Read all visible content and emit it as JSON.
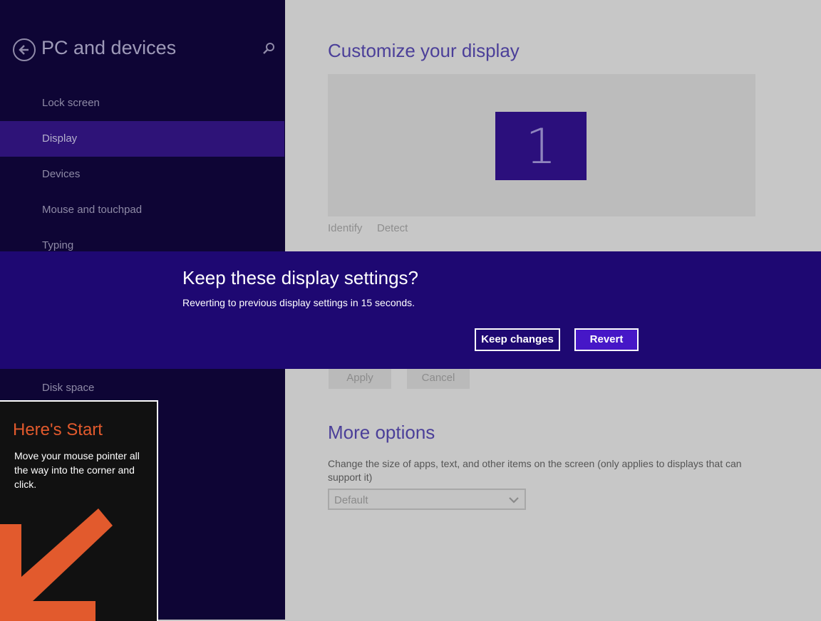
{
  "sidebar": {
    "title": "PC and devices",
    "items": [
      {
        "label": "Lock screen",
        "selected": false
      },
      {
        "label": "Display",
        "selected": true
      },
      {
        "label": "Devices",
        "selected": false
      },
      {
        "label": "Mouse and touchpad",
        "selected": false
      },
      {
        "label": "Typing",
        "selected": false
      },
      {
        "label": "Disk space",
        "selected": false
      }
    ]
  },
  "content": {
    "heading": "Customize your display",
    "monitor_number": "1",
    "identify_link": "Identify",
    "detect_link": "Detect",
    "apply_button": "Apply",
    "cancel_button": "Cancel",
    "more_heading": "More options",
    "more_description": "Change the size of apps, text, and other items on the screen (only applies to displays that can support it)",
    "size_select_value": "Default"
  },
  "dialog": {
    "title": "Keep these display settings?",
    "message": "Reverting to previous display settings in 15 seconds.",
    "keep_button": "Keep changes",
    "revert_button": "Revert"
  },
  "tip": {
    "title": "Here's Start",
    "text": "Move your mouse pointer all the way into the corner and click."
  },
  "colors": {
    "sidebar_bg": "#0e0535",
    "selected_item": "#2e1378",
    "dialog_bg": "#1e0872",
    "accent": "#4617c7",
    "tip_orange": "#e25a2d"
  },
  "icons": {
    "back": "back-arrow-icon",
    "search": "search-icon",
    "dropdown": "chevron-down-icon",
    "tip_arrow": "corner-arrow-icon"
  }
}
